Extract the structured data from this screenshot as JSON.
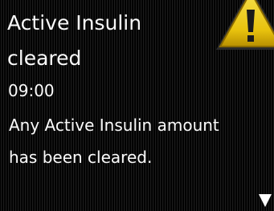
{
  "alert": {
    "title_line_1": "Active Insulin",
    "title_line_2": "cleared",
    "time": "09:00",
    "message_line_1": "Any Active Insulin amount",
    "message_line_2": "has been cleared."
  },
  "icons": {
    "warning": "warning-triangle-icon",
    "scroll": "scroll-down-arrow-icon"
  },
  "colors": {
    "background": "#070707",
    "text": "#fbfbfb",
    "warning_yellow": "#f2cf15"
  }
}
